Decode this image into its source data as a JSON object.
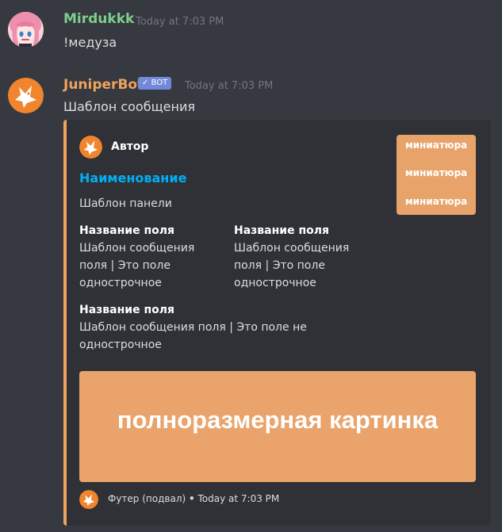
{
  "messages": [
    {
      "username": "Mirdukkk",
      "username_color": "#7dcf8c",
      "timestamp": "Today at 7:03 PM",
      "content": "!медуза",
      "avatar": "anime-girl-avatar"
    },
    {
      "username": "JuniperBot",
      "username_color": "#f0a35e",
      "bot_badge": "✓ BOT",
      "timestamp": "Today at 7:03 PM",
      "content": "Шаблон сообщения",
      "avatar": "juniper-fox-avatar"
    }
  ],
  "embed": {
    "border_color": "#f0a35e",
    "author": "Автор",
    "title": "Наименование",
    "title_color": "#00b0f4",
    "description": "Шаблон панели",
    "thumbnail_lines": [
      "миниатюра",
      "миниатюра",
      "миниатюра"
    ],
    "fields": [
      {
        "name": "Название поля",
        "value_lines": [
          "Шаблон сообщения",
          "поля | Это поле",
          "однострочное"
        ]
      },
      {
        "name": "Название поля",
        "value_lines": [
          "Шаблон сообщения",
          "поля | Это поле",
          "однострочное"
        ]
      },
      {
        "name": "Название поля",
        "value_lines": [
          "Шаблон сообщения поля | Это поле не",
          "однострочное"
        ]
      }
    ],
    "image_text": "полноразмерная картинка",
    "footer_text": "Футер (подвал)",
    "footer_separator": "•",
    "footer_timestamp": "Today at 7:03 PM"
  }
}
